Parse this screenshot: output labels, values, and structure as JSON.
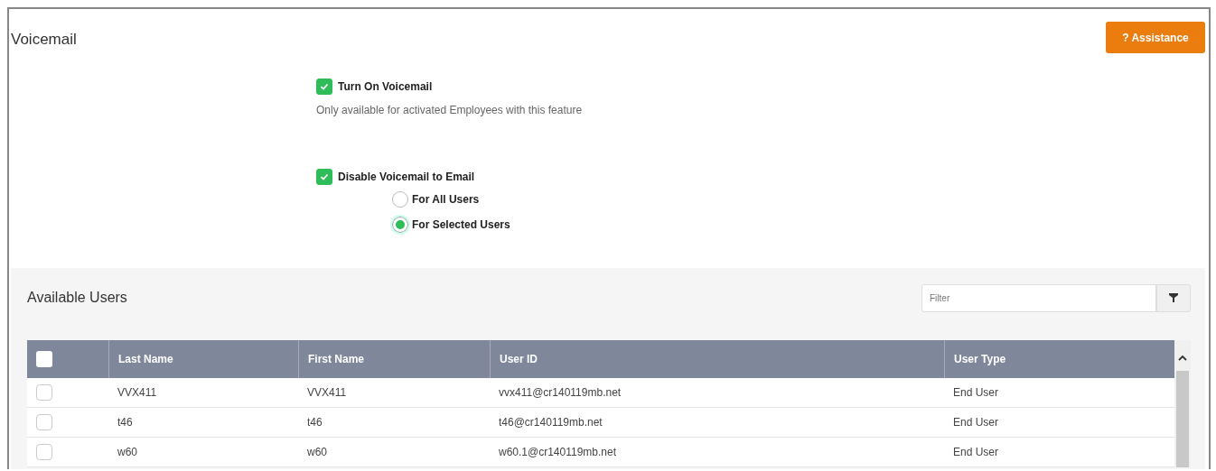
{
  "page": {
    "title": "Voicemail",
    "help_button": "? Assistance"
  },
  "options": [
    {
      "kind": "checkbox",
      "label": "Turn On Voicemail",
      "checked": true,
      "hint": "Only available for activated Employees with this feature"
    },
    {
      "kind": "checkbox",
      "label": "Disable Voicemail to Email",
      "checked": true
    },
    {
      "kind": "radio",
      "label": "For All Users",
      "selected": false
    },
    {
      "kind": "radio",
      "label": "For Selected Users",
      "selected": true
    }
  ],
  "users_panel": {
    "title": "Available Users",
    "filter": {
      "placeholder": "Filter"
    },
    "table": {
      "columns": [
        "Last Name",
        "First Name",
        "User ID",
        "User Type"
      ],
      "header_checked": false,
      "rows": [
        {
          "checked": false,
          "cells": [
            "VVX411",
            "VVX411",
            "vvx411@cr140119mb.net",
            "End User"
          ]
        },
        {
          "checked": false,
          "cells": [
            "t46",
            "t46",
            "t46@cr140119mb.net",
            "End User"
          ]
        },
        {
          "checked": false,
          "cells": [
            "w60",
            "w60",
            "w60.1@cr140119mb.net",
            "End User"
          ]
        }
      ]
    }
  }
}
